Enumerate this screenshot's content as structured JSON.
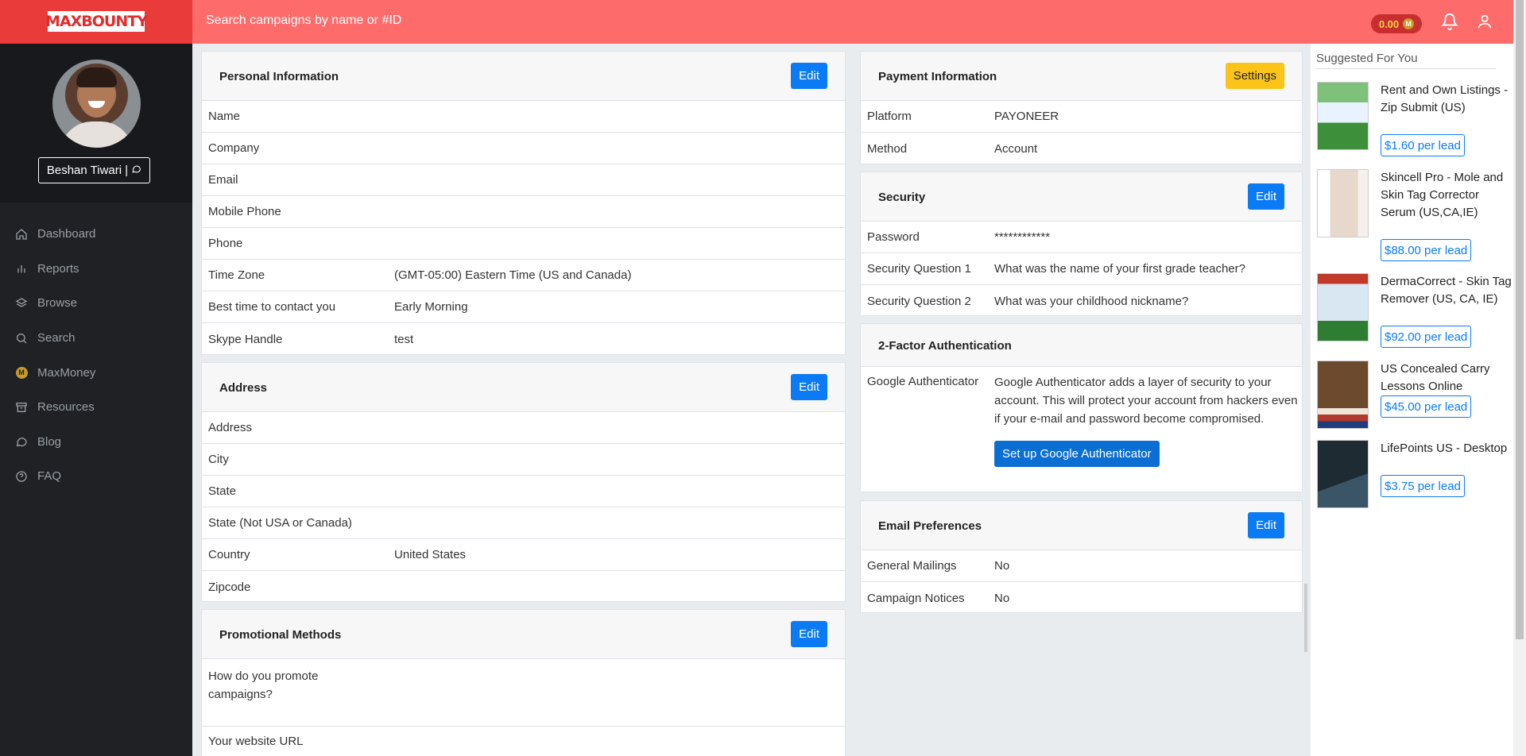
{
  "header": {
    "logo": "MAXBOUNTY",
    "search_placeholder": "Search campaigns by name or #ID",
    "balance": "0.00",
    "coin_icon": "M"
  },
  "profile": {
    "name": "Beshan Tiwari |"
  },
  "sidebar": {
    "items": [
      {
        "label": "Dashboard",
        "icon": "home-icon"
      },
      {
        "label": "Reports",
        "icon": "bar-chart-icon"
      },
      {
        "label": "Browse",
        "icon": "layers-icon"
      },
      {
        "label": "Search",
        "icon": "search-icon"
      },
      {
        "label": "MaxMoney",
        "icon": "coin-icon"
      },
      {
        "label": "Resources",
        "icon": "archive-icon"
      },
      {
        "label": "Blog",
        "icon": "chat-icon"
      },
      {
        "label": "FAQ",
        "icon": "help-icon"
      }
    ]
  },
  "personal": {
    "title": "Personal Information",
    "edit": "Edit",
    "rows": [
      {
        "k": "Name",
        "v": ""
      },
      {
        "k": "Company",
        "v": ""
      },
      {
        "k": "Email",
        "v": ""
      },
      {
        "k": "Mobile Phone",
        "v": ""
      },
      {
        "k": "Phone",
        "v": ""
      },
      {
        "k": "Time Zone",
        "v": "(GMT-05:00) Eastern Time (US and Canada)"
      },
      {
        "k": "Best time to contact you",
        "v": "Early Morning"
      },
      {
        "k": "Skype Handle",
        "v": "test"
      }
    ]
  },
  "address": {
    "title": "Address",
    "edit": "Edit",
    "rows": [
      {
        "k": "Address",
        "v": ""
      },
      {
        "k": "City",
        "v": ""
      },
      {
        "k": "State",
        "v": ""
      },
      {
        "k": "State (Not USA or Canada)",
        "v": ""
      },
      {
        "k": "Country",
        "v": "United States"
      },
      {
        "k": "Zipcode",
        "v": ""
      }
    ]
  },
  "promo": {
    "title": "Promotional Methods",
    "edit": "Edit",
    "q1": "How do you promote campaigns?",
    "q2": "Your website URL"
  },
  "payment": {
    "title": "Payment Information",
    "settings": "Settings",
    "rows": [
      {
        "k": "Platform",
        "v": "PAYONEER"
      },
      {
        "k": "Method",
        "v": "Account"
      }
    ]
  },
  "security": {
    "title": "Security",
    "edit": "Edit",
    "rows": [
      {
        "k": "Password",
        "v": "************"
      },
      {
        "k": "Security Question 1",
        "v": "What was the name of your first grade teacher?"
      },
      {
        "k": "Security Question 2",
        "v": "What was your childhood nickname?"
      }
    ]
  },
  "twofa": {
    "title": "2-Factor Authentication",
    "label": "Google Authenticator",
    "desc": "Google Authenticator adds a layer of security to your account. This will protect your account from hackers even if your e-mail and password become compromised.",
    "button": "Set up Google Authenticator"
  },
  "email": {
    "title": "Email Preferences",
    "edit": "Edit",
    "rows": [
      {
        "k": "General Mailings",
        "v": "No"
      },
      {
        "k": "Campaign Notices",
        "v": "No"
      }
    ]
  },
  "suggested": {
    "title": "Suggested For You",
    "offers": [
      {
        "title": "Rent and Own Listings - Zip Submit (US)",
        "price": "$1.60 per lead",
        "thumb": "#3d8f3a"
      },
      {
        "title": "Skincell Pro - Mole and Skin Tag Corrector Serum (US,CA,IE)",
        "price": "$88.00 per lead",
        "thumb": "#e7d8cc"
      },
      {
        "title": "DermaCorrect - Skin Tag Remover (US, CA, IE)",
        "price": "$92.00 per lead",
        "thumb": "#d9e7f2"
      },
      {
        "title": "US Concealed Carry Lessons Online",
        "price": "$45.00 per lead",
        "thumb": "#6b4a2e"
      },
      {
        "title": "LifePoints US - Desktop",
        "price": "$3.75 per lead",
        "thumb": "#1f2b33"
      }
    ]
  }
}
